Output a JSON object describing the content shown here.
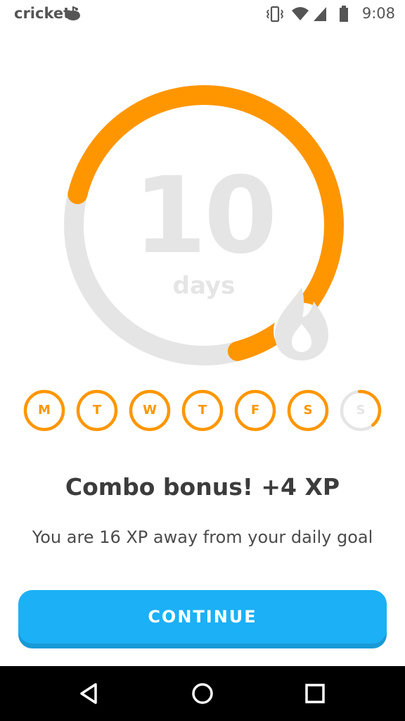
{
  "status_bar": {
    "carrier": "cricket",
    "time": "9:08",
    "icons": [
      "carrier-logo-icon",
      "vibrate-icon",
      "wifi-icon",
      "signal-icon",
      "battery-icon"
    ]
  },
  "streak": {
    "count": "10",
    "unit": "days",
    "progress": 0.67,
    "icons": [
      "flame-icon"
    ]
  },
  "week": {
    "days": [
      {
        "label": "M",
        "state": "complete"
      },
      {
        "label": "T",
        "state": "complete"
      },
      {
        "label": "W",
        "state": "complete"
      },
      {
        "label": "T",
        "state": "complete"
      },
      {
        "label": "F",
        "state": "complete"
      },
      {
        "label": "S",
        "state": "complete"
      },
      {
        "label": "S",
        "state": "partial",
        "progress": 0.4
      }
    ]
  },
  "message": {
    "headline": "Combo bonus! +4 XP",
    "subtext": "You are 16 XP away from your daily goal"
  },
  "actions": {
    "continue_label": "CONTINUE"
  },
  "nav_bar": {
    "icons": [
      "back-icon",
      "home-icon",
      "recents-icon"
    ]
  },
  "colors": {
    "accent_orange": "#ff9600",
    "track_gray": "#e5e5e5",
    "button_blue": "#1cb0f6",
    "button_shadow": "#1899d6",
    "headline_text": "#3c3c3c",
    "body_text": "#4b4b4b"
  }
}
